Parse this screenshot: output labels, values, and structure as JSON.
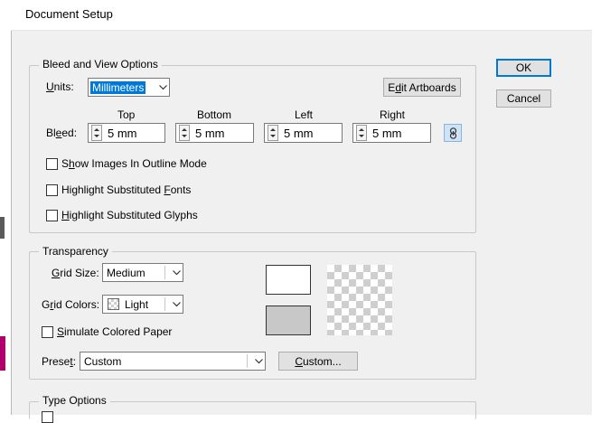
{
  "window": {
    "title": "Document Setup"
  },
  "buttons": {
    "ok": "OK",
    "cancel": "Cancel",
    "edit_artboards": "Edit Artboards",
    "custom": "Custom..."
  },
  "bleed_view": {
    "legend": "Bleed and View Options",
    "units_label": "Units:",
    "units_value": "Millimeters",
    "bleed_label": "Bleed:",
    "columns": [
      "Top",
      "Bottom",
      "Left",
      "Right"
    ],
    "values": [
      "5 mm",
      "5 mm",
      "5 mm",
      "5 mm"
    ],
    "checkboxes": [
      {
        "label": "Show Images In Outline Mode",
        "checked": false
      },
      {
        "label": "Highlight Substituted Fonts",
        "checked": false
      },
      {
        "label": "Highlight Substituted Glyphs",
        "checked": false
      }
    ]
  },
  "transparency": {
    "legend": "Transparency",
    "grid_size_label": "Grid Size:",
    "grid_size_value": "Medium",
    "grid_colors_label": "Grid Colors:",
    "grid_colors_value": "Light",
    "simulate_paper_label": "Simulate Colored Paper",
    "simulate_paper_checked": false,
    "preset_label": "Preset:",
    "preset_value": "Custom"
  },
  "type_options": {
    "legend": "Type Options"
  },
  "icons": {
    "link": "link-icon",
    "spinner": "spinner-arrows-icon",
    "chevron": "chevron-down-icon"
  }
}
